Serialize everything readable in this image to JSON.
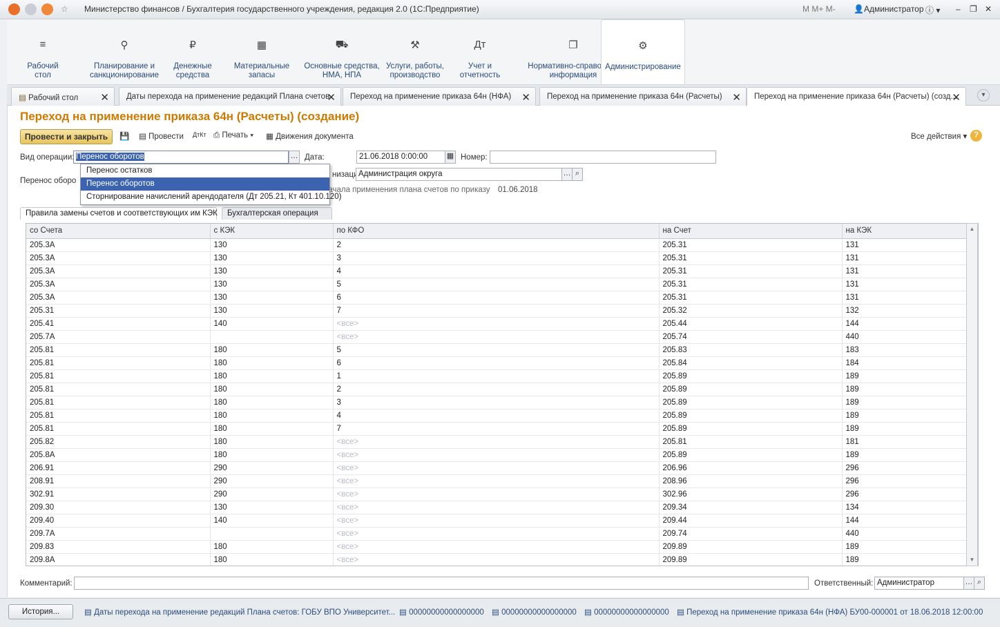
{
  "app": {
    "title": "Министерство финансов / Бухгалтерия государственного учреждения, редакция 2.0  (1С:Предприятие)",
    "user": "Администратор"
  },
  "sections": [
    {
      "label": "Рабочий\nстол",
      "icon": "≡"
    },
    {
      "label": "Планирование и\nсанкционирование",
      "icon": "⚲"
    },
    {
      "label": "Денежные\nсредства",
      "icon": "₽"
    },
    {
      "label": "Материальные\nзапасы",
      "icon": "▦"
    },
    {
      "label": "Основные средства,\nНМА, НПА",
      "icon": "⛟"
    },
    {
      "label": "Услуги, работы,\nпроизводство",
      "icon": "⚒"
    },
    {
      "label": "Учет и\nотчетность",
      "icon": "Дт"
    },
    {
      "label": "Нормативно-справочная\nинформация",
      "icon": "❐"
    },
    {
      "label": "Администрирование",
      "icon": "⚙"
    }
  ],
  "tabs": [
    "Рабочий стол",
    "Даты перехода на применение редакций Плана счетов",
    "Переход на применение приказа 64н (НФА)",
    "Переход на применение приказа 64н (Расчеты)",
    "Переход на применение приказа 64н (Расчеты) (созд..."
  ],
  "doc": {
    "title": "Переход на применение приказа 64н (Расчеты) (создание)"
  },
  "toolbar": {
    "post_close": "Провести и закрыть",
    "post": "Провести",
    "print": "Печать",
    "movements": "Движения документа",
    "all_actions": "Все действия"
  },
  "form": {
    "op_label": "Вид операции:",
    "op_value": "Перенос оборотов",
    "date_label": "Дата:",
    "date_value": "21.06.2018  0:00:00",
    "num_label": "Номер:",
    "org_label": "низация:",
    "org_value": "Администрация округа",
    "side_label": "Перенос оборо",
    "start_label": "начала применения плана счетов по приказу",
    "start_value": "01.06.2018",
    "options": [
      "Перенос остатков",
      "Перенос оборотов",
      "Сторнирование начислений арендодателя (Дт 205.21, Кт 401.10.120)"
    ]
  },
  "subtabs": [
    "Правила замены счетов и соответствующих им КЭК",
    "Бухгалтерская операция"
  ],
  "grid": {
    "columns": [
      "со Счета",
      "с КЭК",
      "по КФО",
      "на Счет",
      "на КЭК"
    ],
    "rows": [
      [
        "205.3А",
        "130",
        "2",
        "205.31",
        "131"
      ],
      [
        "205.3А",
        "130",
        "3",
        "205.31",
        "131"
      ],
      [
        "205.3А",
        "130",
        "4",
        "205.31",
        "131"
      ],
      [
        "205.3А",
        "130",
        "5",
        "205.31",
        "131"
      ],
      [
        "205.3А",
        "130",
        "6",
        "205.31",
        "131"
      ],
      [
        "205.31",
        "130",
        "7",
        "205.32",
        "132"
      ],
      [
        "205.41",
        "140",
        "<все>",
        "205.44",
        "144"
      ],
      [
        "205.7А",
        "",
        "<все>",
        "205.74",
        "440"
      ],
      [
        "205.81",
        "180",
        "5",
        "205.83",
        "183"
      ],
      [
        "205.81",
        "180",
        "6",
        "205.84",
        "184"
      ],
      [
        "205.81",
        "180",
        "1",
        "205.89",
        "189"
      ],
      [
        "205.81",
        "180",
        "2",
        "205.89",
        "189"
      ],
      [
        "205.81",
        "180",
        "3",
        "205.89",
        "189"
      ],
      [
        "205.81",
        "180",
        "4",
        "205.89",
        "189"
      ],
      [
        "205.81",
        "180",
        "7",
        "205.89",
        "189"
      ],
      [
        "205.82",
        "180",
        "<все>",
        "205.81",
        "181"
      ],
      [
        "205.8А",
        "180",
        "<все>",
        "205.89",
        "189"
      ],
      [
        "206.91",
        "290",
        "<все>",
        "206.96",
        "296"
      ],
      [
        "208.91",
        "290",
        "<все>",
        "208.96",
        "296"
      ],
      [
        "302.91",
        "290",
        "<все>",
        "302.96",
        "296"
      ],
      [
        "209.30",
        "130",
        "<все>",
        "209.34",
        "134"
      ],
      [
        "209.40",
        "140",
        "<все>",
        "209.44",
        "144"
      ],
      [
        "209.7А",
        "",
        "<все>",
        "209.74",
        "440"
      ],
      [
        "209.83",
        "180",
        "<все>",
        "209.89",
        "189"
      ],
      [
        "209.8А",
        "180",
        "<все>",
        "209.89",
        "189"
      ]
    ]
  },
  "footer": {
    "comment_label": "Комментарий:",
    "resp_label": "Ответственный:",
    "resp_value": "Администратор"
  },
  "history": {
    "button": "История...",
    "links": [
      "Даты перехода на применение редакций Плана счетов: ГОБУ ВПО Университет...",
      "00000000000000000",
      "00000000000000000",
      "00000000000000000",
      "Переход на применение приказа 64н (НФА) БУ00-000001 от 18.06.2018 12:00:00"
    ]
  }
}
